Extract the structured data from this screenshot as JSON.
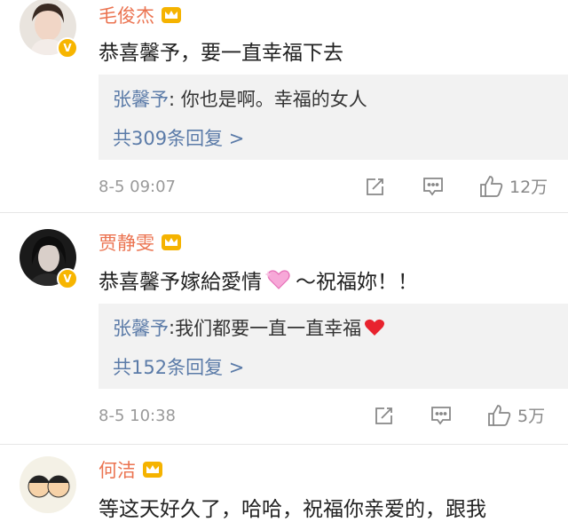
{
  "comments": [
    {
      "author": "毛俊杰",
      "text": "恭喜馨予，要一直幸福下去",
      "reply_author": "张馨予",
      "reply_text": "你也是啊。幸福的女人",
      "reply_count": "共309条回复 >",
      "time": "8-5 09:07",
      "likes": "12万"
    },
    {
      "author": "贾静雯",
      "text_before": "恭喜馨予嫁給愛情",
      "text_after": "～祝福妳！！",
      "reply_author": "张馨予",
      "reply_text": "我们都要一直一直幸福",
      "reply_count": "共152条回复 >",
      "time": "8-5 10:38",
      "likes": "5万"
    },
    {
      "author": "何洁",
      "text": "等这天好久了，哈哈，祝福你亲爱的，跟我"
    }
  ],
  "reply_separator": ": ",
  "verified_badge": "V",
  "icons": [
    "repost-icon",
    "comment-icon",
    "like-icon",
    "crown-icon",
    "verified-badge-icon",
    "heart-emoji",
    "sparkle-heart-emoji"
  ],
  "colors": {
    "name": "#eb7350",
    "reply_name": "#5b7ba8",
    "reply_bg": "#f2f2f2",
    "meta": "#999999"
  }
}
